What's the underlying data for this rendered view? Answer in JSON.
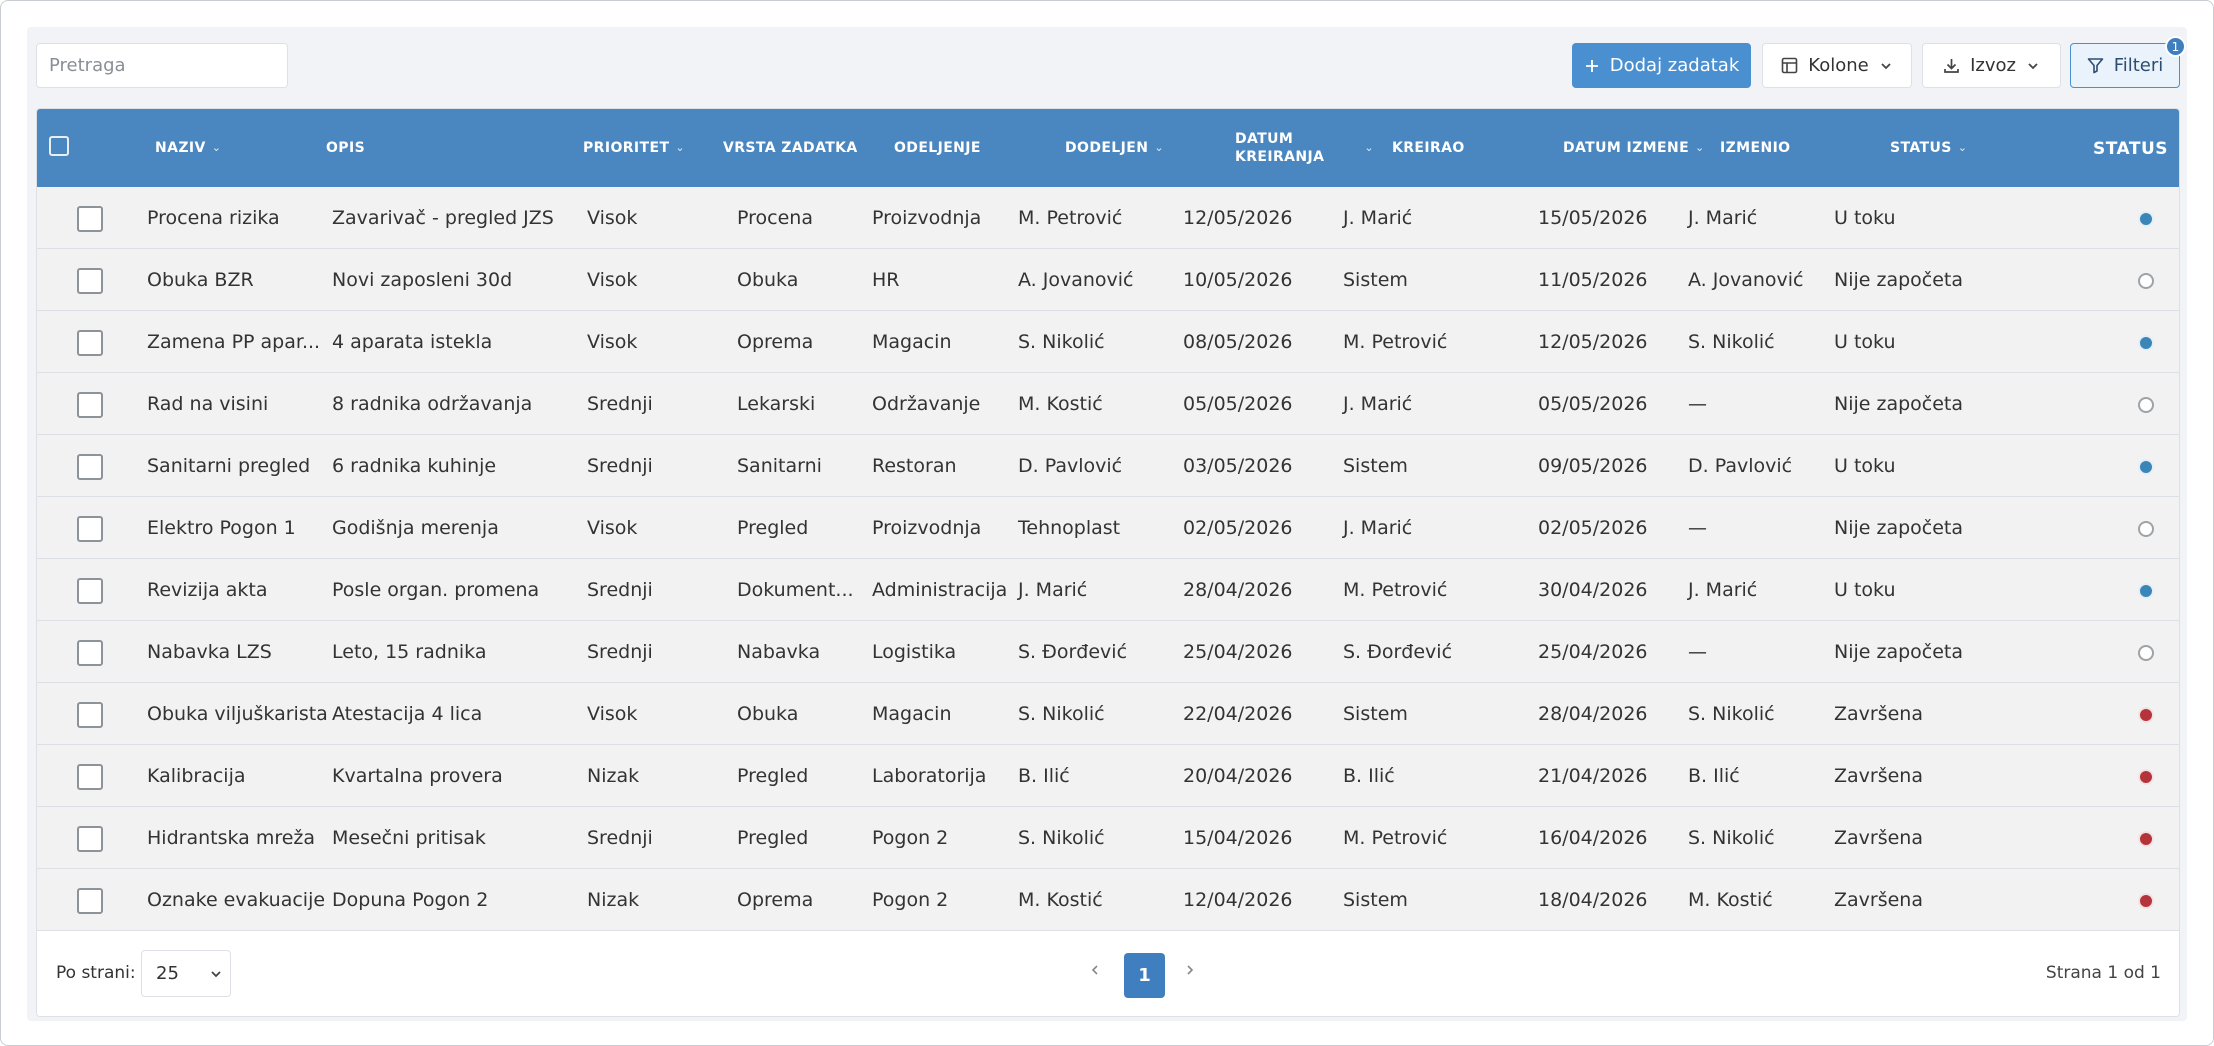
{
  "toolbar": {
    "search_placeholder": "Pretraga",
    "add_task_label": "Dodaj zadatak",
    "columns_label": "Kolone",
    "export_label": "Izvoz",
    "filters_label": "Filteri",
    "filters_badge": "1"
  },
  "table": {
    "headers": {
      "naziv": "NAZIV",
      "opis": "OPIS",
      "prioritet": "PRIORITET",
      "vrsta": "VRSTA ZADATKA",
      "odeljenje": "ODELJENJE",
      "dodeljen": "DODELJEN",
      "datum_kreiranja_1": "DATUM",
      "datum_kreiranja_2": "KREIRANJA",
      "kreirao": "KREIRAO",
      "datum_izmene": "DATUM IZMENE",
      "izmenio": "IZMENIO",
      "status": "STATUS",
      "status_indicator": "STATUS"
    },
    "rows": [
      {
        "naziv": "Procena rizika",
        "opis": "Zavarivač - pregled JZS",
        "prioritet": "Visok",
        "vrsta": "Procena",
        "odeljenje": "Proizvodnja",
        "dodeljen": "M. Petrović",
        "datum_kreiranja": "12/05/2026",
        "kreirao": "J. Marić",
        "datum_izmene": "15/05/2026",
        "izmenio": "J. Marić",
        "status": "U toku",
        "dot": "blue"
      },
      {
        "naziv": "Obuka BZR",
        "opis": "Novi zaposleni 30d",
        "prioritet": "Visok",
        "vrsta": "Obuka",
        "odeljenje": "HR",
        "dodeljen": "A. Jovanović",
        "datum_kreiranja": "10/05/2026",
        "kreirao": "Sistem",
        "datum_izmene": "11/05/2026",
        "izmenio": "A. Jovanović",
        "status": "Nije započeta",
        "dot": "empty"
      },
      {
        "naziv": "Zamena PP apar...",
        "opis": "4 aparata istekla",
        "prioritet": "Visok",
        "vrsta": "Oprema",
        "odeljenje": "Magacin",
        "dodeljen": "S. Nikolić",
        "datum_kreiranja": "08/05/2026",
        "kreirao": "M. Petrović",
        "datum_izmene": "12/05/2026",
        "izmenio": "S. Nikolić",
        "status": "U toku",
        "dot": "blue"
      },
      {
        "naziv": "Rad na visini",
        "opis": "8 radnika održavanja",
        "prioritet": "Srednji",
        "vrsta": "Lekarski",
        "odeljenje": "Održavanje",
        "dodeljen": "M. Kostić",
        "datum_kreiranja": "05/05/2026",
        "kreirao": "J. Marić",
        "datum_izmene": "05/05/2026",
        "izmenio": "—",
        "status": "Nije započeta",
        "dot": "empty"
      },
      {
        "naziv": "Sanitarni pregled",
        "opis": "6 radnika kuhinje",
        "prioritet": "Srednji",
        "vrsta": "Sanitarni",
        "odeljenje": "Restoran",
        "dodeljen": "D. Pavlović",
        "datum_kreiranja": "03/05/2026",
        "kreirao": "Sistem",
        "datum_izmene": "09/05/2026",
        "izmenio": "D. Pavlović",
        "status": "U toku",
        "dot": "blue"
      },
      {
        "naziv": "Elektro Pogon 1",
        "opis": "Godišnja merenja",
        "prioritet": "Visok",
        "vrsta": "Pregled",
        "odeljenje": "Proizvodnja",
        "dodeljen": "Tehnoplast",
        "datum_kreiranja": "02/05/2026",
        "kreirao": "J. Marić",
        "datum_izmene": "02/05/2026",
        "izmenio": "—",
        "status": "Nije započeta",
        "dot": "empty"
      },
      {
        "naziv": "Revizija akta",
        "opis": "Posle organ. promena",
        "prioritet": "Srednji",
        "vrsta": "Dokument...",
        "odeljenje": "Administracija",
        "dodeljen": "J. Marić",
        "datum_kreiranja": "28/04/2026",
        "kreirao": "M. Petrović",
        "datum_izmene": "30/04/2026",
        "izmenio": "J. Marić",
        "status": "U toku",
        "dot": "blue"
      },
      {
        "naziv": "Nabavka LZS",
        "opis": "Leto, 15 radnika",
        "prioritet": "Srednji",
        "vrsta": "Nabavka",
        "odeljenje": "Logistika",
        "dodeljen": "S. Đorđević",
        "datum_kreiranja": "25/04/2026",
        "kreirao": "S. Đorđević",
        "datum_izmene": "25/04/2026",
        "izmenio": "—",
        "status": "Nije započeta",
        "dot": "empty"
      },
      {
        "naziv": "Obuka viljuškarista",
        "opis": "Atestacija 4 lica",
        "prioritet": "Visok",
        "vrsta": "Obuka",
        "odeljenje": "Magacin",
        "dodeljen": "S. Nikolić",
        "datum_kreiranja": "22/04/2026",
        "kreirao": "Sistem",
        "datum_izmene": "28/04/2026",
        "izmenio": "S. Nikolić",
        "status": "Završena",
        "dot": "red"
      },
      {
        "naziv": "Kalibracija",
        "opis": "Kvartalna provera",
        "prioritet": "Nizak",
        "vrsta": "Pregled",
        "odeljenje": "Laboratorija",
        "dodeljen": "B. Ilić",
        "datum_kreiranja": "20/04/2026",
        "kreirao": "B. Ilić",
        "datum_izmene": "21/04/2026",
        "izmenio": "B. Ilić",
        "status": "Završena",
        "dot": "red"
      },
      {
        "naziv": "Hidrantska mreža",
        "opis": "Mesečni pritisak",
        "prioritet": "Srednji",
        "vrsta": "Pregled",
        "odeljenje": "Pogon 2",
        "dodeljen": "S. Nikolić",
        "datum_kreiranja": "15/04/2026",
        "kreirao": "M. Petrović",
        "datum_izmene": "16/04/2026",
        "izmenio": "S. Nikolić",
        "status": "Završena",
        "dot": "red"
      },
      {
        "naziv": "Oznake evakuacije",
        "opis": "Dopuna Pogon 2",
        "prioritet": "Nizak",
        "vrsta": "Oprema",
        "odeljenje": "Pogon 2",
        "dodeljen": "M. Kostić",
        "datum_kreiranja": "12/04/2026",
        "kreirao": "Sistem",
        "datum_izmene": "18/04/2026",
        "izmenio": "M. Kostić",
        "status": "Završena",
        "dot": "red"
      }
    ]
  },
  "footer": {
    "per_page_label": "Po strani:",
    "per_page_value": "25",
    "current_page": "1",
    "page_info": "Strana 1 od 1"
  },
  "colors": {
    "header_bg": "#4a87c0",
    "primary": "#4a8fd0",
    "dot_blue": "#3a86b8",
    "dot_red": "#b5343b"
  },
  "icons": {
    "add": "plus-icon",
    "columns": "columns-icon",
    "export": "download-icon",
    "filters": "filter-icon",
    "sort": "sort-icon",
    "chevron": "chevron-down-icon",
    "prev": "chevron-left-icon",
    "next": "chevron-right-icon"
  }
}
